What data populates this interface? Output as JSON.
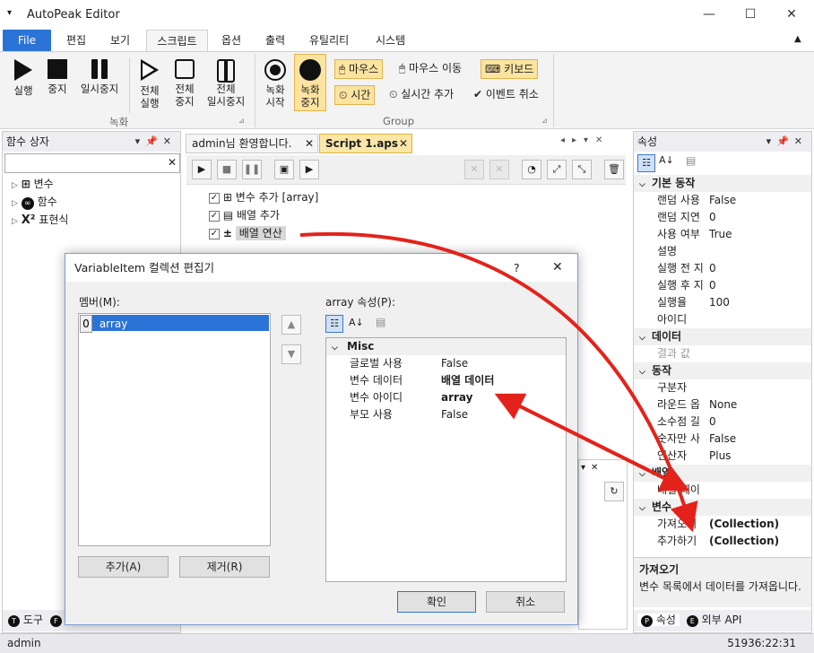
{
  "app": {
    "title": "AutoPeak Editor"
  },
  "window_controls": {
    "minimize": "—",
    "maximize": "☐",
    "close": "✕"
  },
  "ribbon_tabs": [
    "File",
    "편집",
    "보기",
    "스크립트",
    "옵션",
    "출력",
    "유틸리티",
    "시스템"
  ],
  "ribbon_selected": "스크립트",
  "ribbon": {
    "rec_buttons": [
      {
        "label": "실행",
        "icon": "play-icon"
      },
      {
        "label": "중지",
        "icon": "stop-icon"
      },
      {
        "label": "일시중지",
        "icon": "pause-icon"
      },
      {
        "label": "전체\n실행",
        "icon": "play-all-icon"
      },
      {
        "label": "전체\n중지",
        "icon": "stop-all-icon"
      },
      {
        "label": "전체\n일시중지",
        "icon": "pause-all-icon"
      }
    ],
    "rec_group": "녹화",
    "rec_start": "녹화\n시작",
    "rec_stop": "녹화\n중지",
    "mouse": "마우스",
    "mouse_move": "마우스 이동",
    "keyboard": "키보드",
    "time": "시간",
    "realtime_add": "실시간 추가",
    "event_cancel": "이벤트 취소",
    "group2": "Group"
  },
  "left_panel": {
    "title": "함수 상자",
    "search_value": "",
    "items": [
      {
        "label": "변수",
        "icon": "variable-icon"
      },
      {
        "label": "함수",
        "icon": "function-icon"
      },
      {
        "label": "표현식",
        "icon": "expression-icon"
      }
    ],
    "bottom_tabs": [
      "도구",
      "F"
    ]
  },
  "doc_tabs": [
    {
      "label": "admin님 환영합니다.",
      "active": false
    },
    {
      "label": "Script 1.aps",
      "active": true
    }
  ],
  "script_items": [
    {
      "label": "변수 추가 [array]"
    },
    {
      "label": "배열 추가"
    },
    {
      "label": "배열 연산"
    }
  ],
  "properties": {
    "title": "속성",
    "categories": [
      {
        "name": "기본 동작",
        "rows": [
          {
            "name": "랜덤 사용",
            "value": "False"
          },
          {
            "name": "랜덤 지연",
            "value": "0"
          },
          {
            "name": "사용 여부",
            "value": "True"
          },
          {
            "name": "설명",
            "value": ""
          },
          {
            "name": "실행 전 지",
            "value": "0"
          },
          {
            "name": "실행 후 지",
            "value": "0"
          },
          {
            "name": "실행율",
            "value": "100"
          },
          {
            "name": "아이디",
            "value": ""
          }
        ]
      },
      {
        "name": "데이터",
        "rows": [
          {
            "name": "결과 값",
            "value": ""
          }
        ]
      },
      {
        "name": "동작",
        "rows": [
          {
            "name": "구분자",
            "value": ""
          },
          {
            "name": "라운드 옵",
            "value": "None"
          },
          {
            "name": "소수점 길",
            "value": "0"
          },
          {
            "name": "숫자만 사",
            "value": "False"
          },
          {
            "name": "연산자",
            "value": "Plus"
          }
        ]
      },
      {
        "name": "배열",
        "rows": [
          {
            "name": "배열 데이",
            "value": ""
          }
        ]
      },
      {
        "name": "변수",
        "rows": [
          {
            "name": "가져오기",
            "value": "(Collection)"
          },
          {
            "name": "추가하기",
            "value": "(Collection)"
          }
        ]
      }
    ],
    "desc_title": "가져오기",
    "desc_text": "변수 목록에서 데이터를 가져옵니다.",
    "bottom_tabs": [
      "속성",
      "외부 API"
    ]
  },
  "dialog": {
    "title": "VariableItem 컬렉션 편집기",
    "help": "?",
    "members_label": "멤버(M):",
    "members": [
      {
        "index": "0",
        "name": "array"
      }
    ],
    "props_label": "array 속성(P):",
    "category": "Misc",
    "rows": [
      {
        "name": "글로벌 사용",
        "value": "False",
        "bold": false
      },
      {
        "name": "변수 데이터",
        "value": "배열 데이터",
        "bold": true
      },
      {
        "name": "변수 아이디",
        "value": "array",
        "bold": true
      },
      {
        "name": "부모 사용",
        "value": "False",
        "bold": false
      }
    ],
    "add": "추가(A)",
    "remove": "제거(R)",
    "ok": "확인",
    "cancel": "취소"
  },
  "status": {
    "user": "admin",
    "time": "51936:22:31"
  },
  "colors": {
    "accent": "#2b73d6",
    "highlight": "#fbe3a0",
    "arrow": "#e3231b"
  }
}
